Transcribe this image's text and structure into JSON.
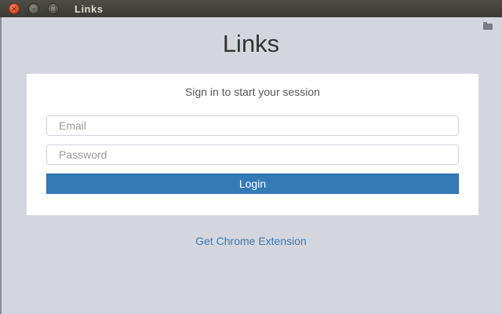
{
  "window": {
    "title": "Links",
    "close_glyph": "×",
    "min_glyph": "–",
    "max_glyph": "□"
  },
  "app": {
    "heading": "Links"
  },
  "login": {
    "message": "Sign in to start your session",
    "email_placeholder": "Email",
    "password_placeholder": "Password",
    "button_label": "Login"
  },
  "footer": {
    "extension_link": "Get Chrome Extension"
  },
  "colors": {
    "background": "#d4d6dd",
    "primary": "#337ab7",
    "link": "#3c7ab0"
  }
}
